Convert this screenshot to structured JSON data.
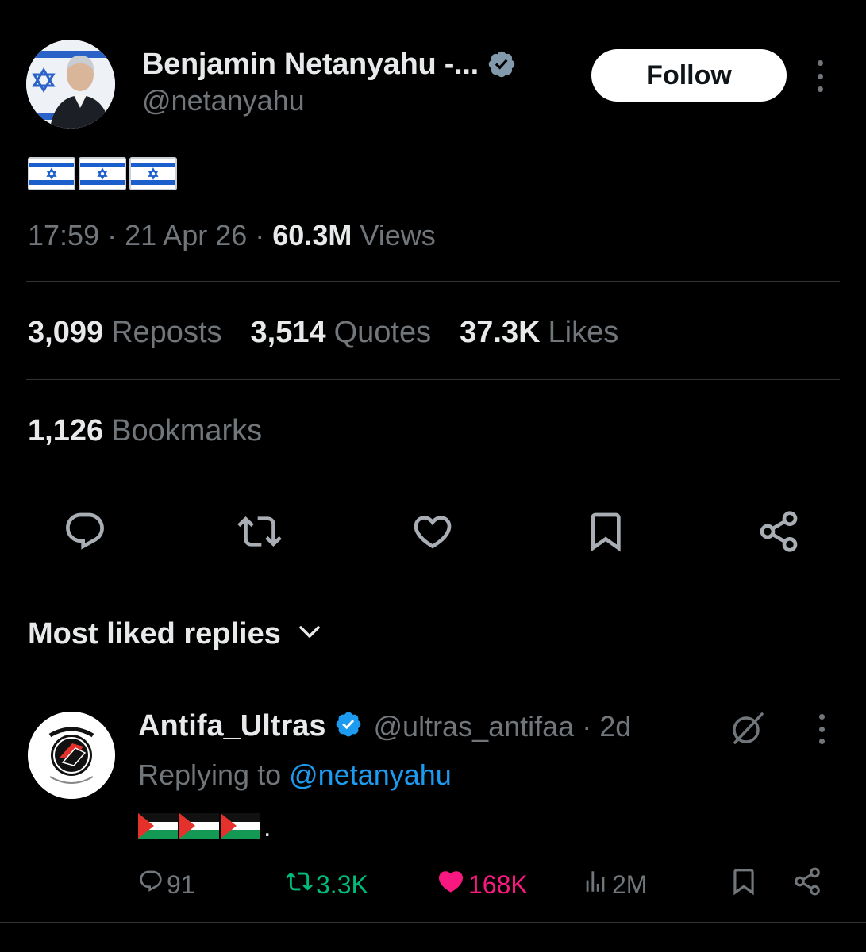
{
  "post": {
    "author": {
      "name": "Benjamin Netanyahu -...",
      "handle": "@netanyahu",
      "verified": true
    },
    "follow_label": "Follow",
    "content_emoji": [
      "israel-flag",
      "israel-flag",
      "israel-flag"
    ],
    "meta": {
      "time": "17:59",
      "sep": "·",
      "date": "21 Apr 26",
      "views_count": "60.3M",
      "views_label": "Views"
    },
    "stats": {
      "reposts_count": "3,099",
      "reposts_label": "Reposts",
      "quotes_count": "3,514",
      "quotes_label": "Quotes",
      "likes_count": "37.3K",
      "likes_label": "Likes",
      "bookmarks_count": "1,126",
      "bookmarks_label": "Bookmarks"
    },
    "actions": [
      "reply-icon",
      "repost-icon",
      "like-icon",
      "bookmark-icon",
      "share-icon"
    ]
  },
  "replies_sort": {
    "label": "Most liked replies",
    "icon": "chevron-down-icon"
  },
  "reply": {
    "author": {
      "name": "Antifa_Ultras",
      "handle": "@ultras_antifaa",
      "verified": true
    },
    "sep": "·",
    "age": "2d",
    "replying_prefix": "Replying to",
    "replying_handle": "@netanyahu",
    "content_emoji": [
      "palestine-flag",
      "palestine-flag",
      "palestine-flag"
    ],
    "content_suffix": ".",
    "actions": {
      "replies": "91",
      "reposts": "3.3K",
      "likes": "168K",
      "views": "2M"
    }
  },
  "colors": {
    "background": "#000000",
    "text_primary": "#e7e9ea",
    "text_secondary": "#71767b",
    "link": "#1d9bf0",
    "verified": "#1d9bf0",
    "repost_active": "#00ba7c",
    "like_active": "#f91880",
    "divider": "#2f3336"
  }
}
